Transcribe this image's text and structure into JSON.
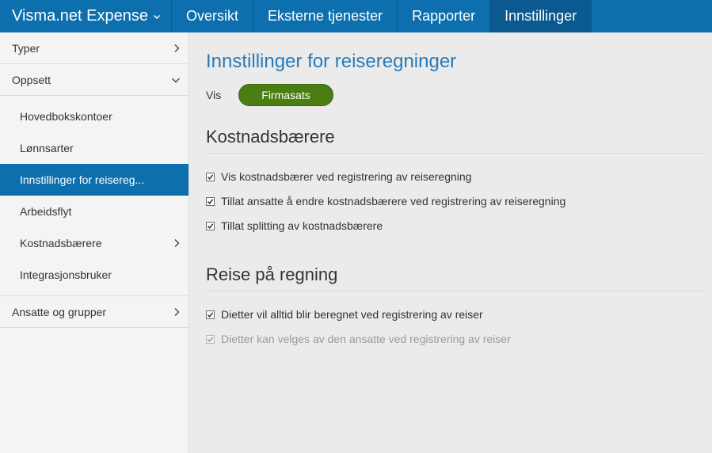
{
  "topbar": {
    "brand": "Visma.net Expense",
    "nav": [
      "Oversikt",
      "Eksterne tjenester",
      "Rapporter",
      "Innstillinger"
    ],
    "active_nav": "Innstillinger"
  },
  "sidebar": {
    "sections": {
      "typer": "Typer",
      "oppsett": "Oppsett",
      "ansatte": "Ansatte og grupper"
    },
    "oppsett_items": [
      "Hovedbokskontoer",
      "Lønnsarter",
      "Innstillinger for reisereg...",
      "Arbeidsflyt",
      "Kostnadsbærere",
      "Integrasjonsbruker"
    ]
  },
  "main": {
    "title": "Innstillinger for reiseregninger",
    "vis_label": "Vis",
    "rate_button": "Firmasats",
    "sections": [
      {
        "heading": "Kostnadsbærere",
        "options": [
          {
            "label": "Vis kostnadsbærer ved registrering av reiseregning",
            "checked": true,
            "disabled": false
          },
          {
            "label": "Tillat ansatte å endre kostnadsbærere ved registrering av reiseregning",
            "checked": true,
            "disabled": false
          },
          {
            "label": "Tillat splitting av kostnadsbærere",
            "checked": true,
            "disabled": false
          }
        ]
      },
      {
        "heading": "Reise på regning",
        "options": [
          {
            "label": "Dietter vil alltid blir beregnet ved registrering av reiser",
            "checked": true,
            "disabled": false
          },
          {
            "label": "Dietter kan velges av den ansatte ved registrering av reiser",
            "checked": true,
            "disabled": true
          }
        ]
      }
    ]
  },
  "colors": {
    "brand_blue": "#0e6fae",
    "active_blue": "#0a5a8f",
    "title_blue": "#2a7ab8",
    "button_green": "#4a7d12"
  }
}
